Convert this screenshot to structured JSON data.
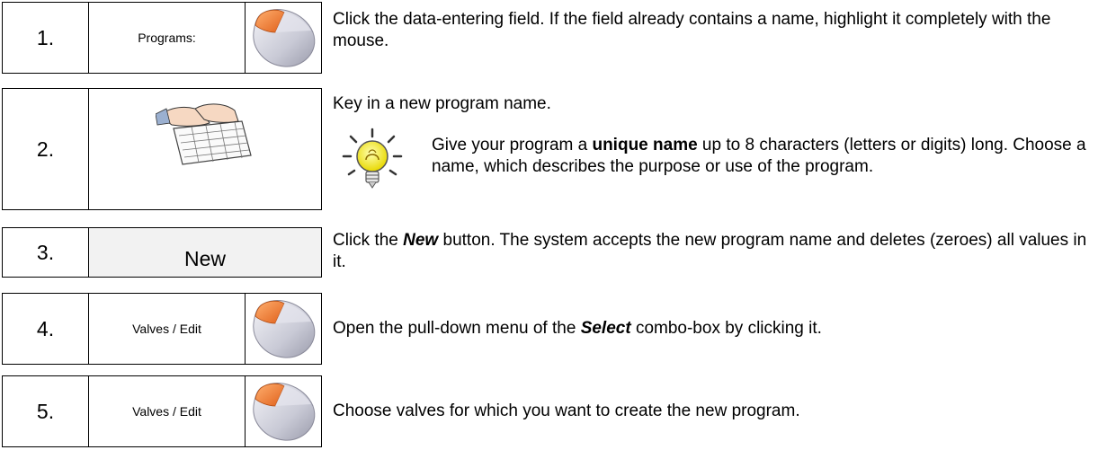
{
  "steps": [
    {
      "number": "1.",
      "control": "Programs:"
    },
    {
      "number": "2.",
      "control": ""
    },
    {
      "number": "3.",
      "control": "New"
    },
    {
      "number": "4.",
      "control": "Valves / Edit"
    },
    {
      "number": "5.",
      "control": "Valves / Edit"
    }
  ],
  "text": {
    "step1": "Click the data-entering field. If the field already contains a name, highlight it completely with the mouse.",
    "step2": "Key in a new program name.",
    "tip_pre": "Give your program a ",
    "tip_bold": "unique name",
    "tip_post": " up to 8 characters (letters or digits) long. Choose a name, which describes the purpose or use of the program.",
    "step3_pre": "Click the ",
    "step3_bold": "New",
    "step3_post": " button. The system accepts the new program name and deletes (zeroes) all values in it.",
    "step4_pre": "Open the pull-down menu of the ",
    "step4_bold": "Select",
    "step4_post": " combo-box by clicking it.",
    "step5": "Choose valves for which you want to create the new program."
  },
  "icons": [
    "mouse-icon",
    "keyboard-icon",
    "lightbulb-icon"
  ]
}
